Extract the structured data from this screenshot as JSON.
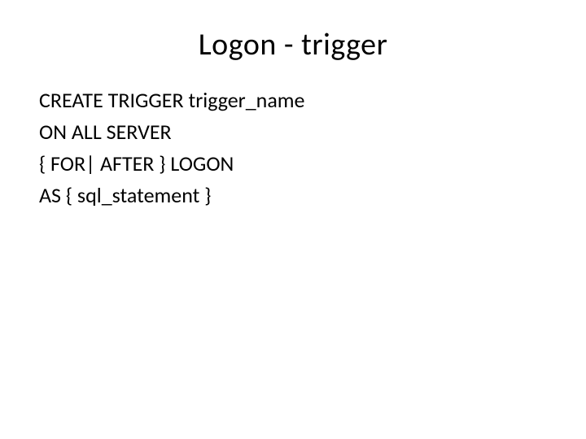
{
  "slide": {
    "title": "Logon - trigger",
    "lines": [
      "CREATE TRIGGER trigger_name",
      "ON ALL SERVER",
      "{ FOR| AFTER } LOGON",
      "AS { sql_statement }"
    ]
  }
}
